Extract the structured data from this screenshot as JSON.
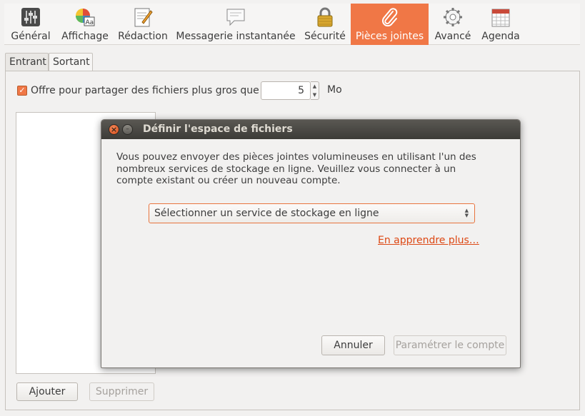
{
  "toolbar": {
    "items": [
      {
        "label": "Général",
        "icon": "sliders-icon"
      },
      {
        "label": "Affichage",
        "icon": "display-icon"
      },
      {
        "label": "Rédaction",
        "icon": "compose-icon"
      },
      {
        "label": "Messagerie instantanée",
        "icon": "chat-icon"
      },
      {
        "label": "Sécurité",
        "icon": "lock-icon"
      },
      {
        "label": "Pièces jointes",
        "icon": "paperclip-icon"
      },
      {
        "label": "Avancé",
        "icon": "gear-icon"
      },
      {
        "label": "Agenda",
        "icon": "calendar-icon"
      }
    ],
    "active": "Pièces jointes",
    "active_color": "#f07746"
  },
  "tabs": {
    "incoming": "Entrant",
    "outgoing": "Sortant",
    "selected": "Sortant"
  },
  "outgoing": {
    "offer_label": "Offre pour partager des fichiers plus gros que",
    "offer_checked": true,
    "size_value": "5",
    "size_unit": "Mo",
    "add_button": "Ajouter",
    "remove_button": "Supprimer"
  },
  "dialog": {
    "title": "Définir l'espace de fichiers",
    "description": "Vous pouvez envoyer des pièces jointes volumineuses en utilisant l'un des nombreux services de stockage en ligne. Veuillez vous connecter à un compte existant ou créer un nouveau compte.",
    "select_value": "Sélectionner un service de stockage en ligne",
    "learn_more": "En apprendre plus…",
    "cancel_button": "Annuler",
    "setup_button": "Paramétrer le compte",
    "accent_color": "#dd4814"
  }
}
